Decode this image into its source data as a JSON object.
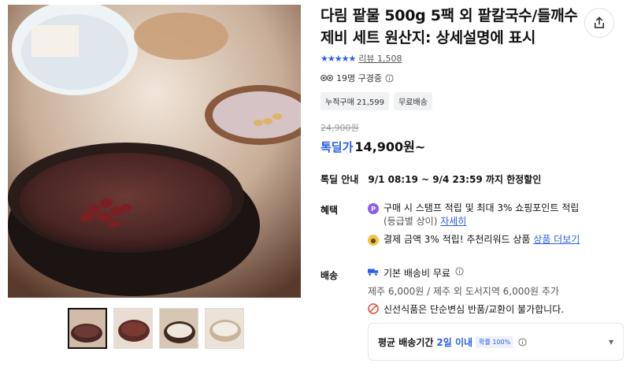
{
  "product": {
    "title": "다림 팥물 500g 5팩 외 팥칼국수/들깨수제비 세트 원산지: 상세설명에 표시",
    "rating_stars": "★★★★★",
    "review_text": "리뷰 1,508",
    "viewers_text": "19명 구경중",
    "badges": [
      "누적구매 21,599",
      "무료배송"
    ],
    "original_price": "24,900원",
    "price_label": "톡딜가",
    "price": "14,900원~",
    "special": {
      "label": "톡딜 안내",
      "text": "9/1 08:19 ~ 9/4 23:59 까지 한정할인"
    }
  },
  "benefits": {
    "label": "혜택",
    "line1": "구매 시 스탬프 적립 및 최대 3% 쇼핑포인트 적립",
    "line2_prefix": "(등급별 상이)",
    "line2_link": "자세히",
    "line3_prefix": "결제 금액 3% 적립! 추천리워드 상품",
    "line3_link": "상품 더보기"
  },
  "shipping": {
    "label": "배송",
    "line1": "기본 배송비 무료",
    "line2": "제주 6,000원 / 제주 외 도서지역 6,000원 추가",
    "line3": "신선식품은 단순변심 반품/교환이 불가합니다.",
    "card_label": "평균 배송기간",
    "card_days": "2일 이내",
    "card_badge": "확률 100%"
  },
  "colors": {
    "accent": "#2a5ee8",
    "warning": "#e0463c",
    "point": "#8b5cf6",
    "reward": "#f5c542"
  },
  "icons": [
    "share-icon",
    "eye-icon",
    "info-icon",
    "point-icon",
    "reward-icon",
    "truck-icon",
    "prohibited-icon",
    "chevron-down-icon"
  ]
}
